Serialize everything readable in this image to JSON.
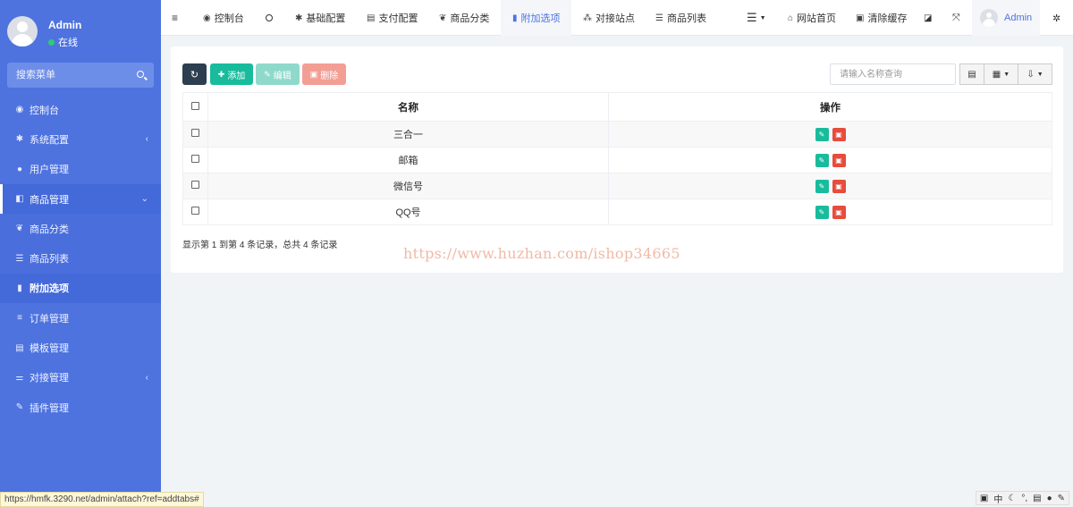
{
  "sidebar": {
    "user": {
      "name": "Admin",
      "status": "在线"
    },
    "search_placeholder": "搜索菜单",
    "items": [
      {
        "label": "控制台",
        "icon": "dashboard-icon",
        "glyph": "◉"
      },
      {
        "label": "系统配置",
        "icon": "gear-icon",
        "glyph": "✱",
        "caret": "‹"
      },
      {
        "label": "用户管理",
        "icon": "user-icon",
        "glyph": "●"
      },
      {
        "label": "商品管理",
        "icon": "cart-icon",
        "glyph": "◧",
        "caret": "⌄"
      },
      {
        "label": "商品分类",
        "icon": "leaf-icon",
        "glyph": "❦"
      },
      {
        "label": "商品列表",
        "icon": "list-icon",
        "glyph": "☰"
      },
      {
        "label": "附加选项",
        "icon": "bookmark-icon",
        "glyph": "▮"
      },
      {
        "label": "订单管理",
        "icon": "bars-icon",
        "glyph": "≡"
      },
      {
        "label": "模板管理",
        "icon": "template-icon",
        "glyph": "▤"
      },
      {
        "label": "对接管理",
        "icon": "sliders-icon",
        "glyph": "⚌",
        "caret": "‹"
      },
      {
        "label": "插件管理",
        "icon": "plug-icon",
        "glyph": "✎"
      }
    ]
  },
  "topbar": {
    "tabs": [
      {
        "label": "控制台",
        "icon": "dashboard-icon",
        "glyph": "◉"
      },
      {
        "label": "基础配置",
        "icon": "gear-icon",
        "glyph": "✱"
      },
      {
        "label": "支付配置",
        "icon": "server-icon",
        "glyph": "▤"
      },
      {
        "label": "商品分类",
        "icon": "leaf-icon",
        "glyph": "❦"
      },
      {
        "label": "附加选项",
        "icon": "bookmark-icon",
        "glyph": "▮"
      },
      {
        "label": "对接站点",
        "icon": "sitemap-icon",
        "glyph": "⁂"
      },
      {
        "label": "商品列表",
        "icon": "list-icon",
        "glyph": "☰"
      }
    ],
    "site_home": "网站首页",
    "clear_cache": "清除缓存",
    "user_name": "Admin"
  },
  "toolbar": {
    "add_label": "添加",
    "edit_label": "编辑",
    "delete_label": "删除",
    "search_placeholder": "请输入名称查询"
  },
  "table": {
    "columns": [
      "名称",
      "操作"
    ],
    "rows": [
      {
        "name": "三合一"
      },
      {
        "name": "邮箱"
      },
      {
        "name": "微信号"
      },
      {
        "name": "QQ号"
      }
    ]
  },
  "summary": "显示第 1 到第 4 条记录，总共 4 条记录",
  "watermark": "https://www.huzhan.com/ishop34665",
  "statusbar": {
    "url": "https://hmfk.3290.net/admin/attach?ref=addtabs#"
  },
  "ime": {
    "mode": "中"
  }
}
